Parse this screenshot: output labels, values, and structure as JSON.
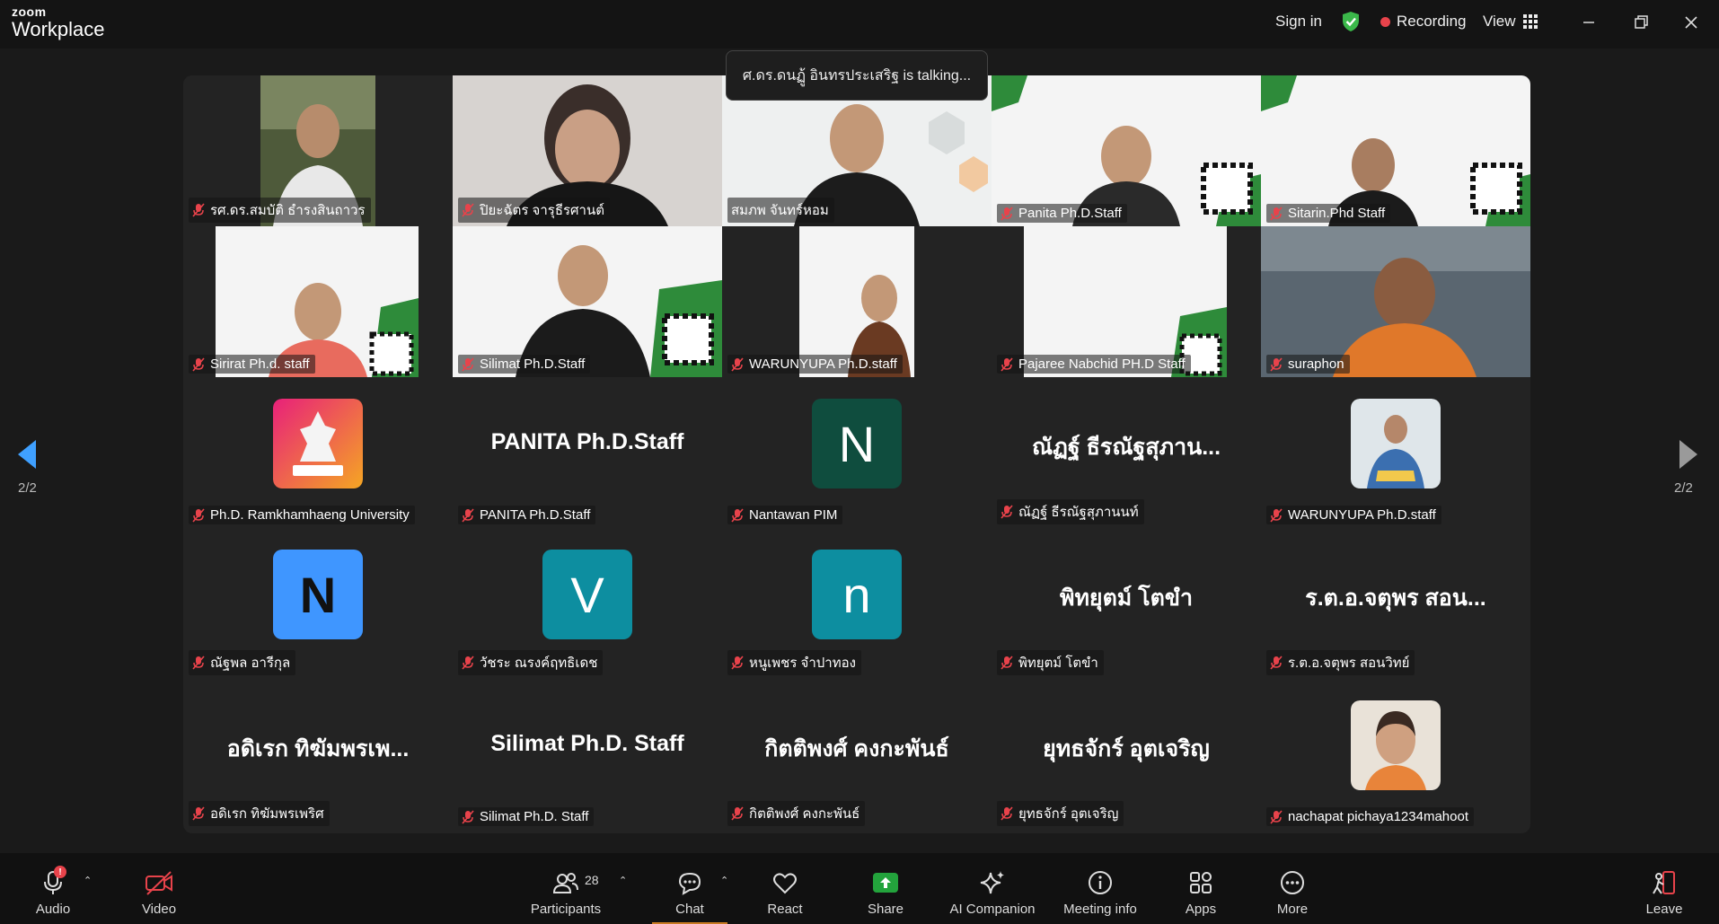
{
  "app": {
    "logo_top": "zoom",
    "logo_bottom": "Workplace"
  },
  "topbar": {
    "sign_in": "Sign in",
    "recording": "Recording",
    "view": "View",
    "colors": {
      "shield": "#3bb84a",
      "recording_dot": "#e8434b"
    }
  },
  "talking_banner": "ศ.ดร.ดนฏู้ อินทรประเสริฐ is talking...",
  "tiles": [
    {
      "name": "รศ.ดร.สมบัติ ธำรงสินถาวร",
      "type": "video"
    },
    {
      "name": "ปิยะฉัตร จารุธีรศานต์",
      "type": "video"
    },
    {
      "name": "สมภพ จันทร์หอม",
      "type": "video"
    },
    {
      "name": "Panita Ph.D.Staff",
      "type": "video"
    },
    {
      "name": "Sitarin.Phd Staff",
      "type": "video"
    },
    {
      "name": "Sirirat Ph.d. staff",
      "type": "video"
    },
    {
      "name": "Silimat Ph.D.Staff",
      "type": "video"
    },
    {
      "name": "WARUNYUPA Ph.D.staff",
      "type": "video"
    },
    {
      "name": "Pajaree Nabchid PH.D Staff",
      "type": "video"
    },
    {
      "name": "suraphon",
      "type": "video"
    },
    {
      "name": "Ph.D. Ramkhamhaeng University",
      "type": "avatar-image"
    },
    {
      "name": "PANITA Ph.D.Staff",
      "display": "PANITA Ph.D.Staff",
      "type": "text"
    },
    {
      "name": "Nantawan PIM",
      "initial": "N",
      "type": "initial",
      "color": "#0f4d3e"
    },
    {
      "name": "ณัฏฐ์ ธีรณัฐสุภานนท์",
      "display": "ณัฏฐ์ ธีรณัฐสุภาน...",
      "type": "text"
    },
    {
      "name": "WARUNYUPA Ph.D.staff",
      "type": "avatar-image"
    },
    {
      "name": "ณัฐพล อารีกุล",
      "initial": "N",
      "type": "initial",
      "color": "#3f96ff"
    },
    {
      "name": "วัชระ ณรงค์ฤทธิเดช",
      "initial": "V",
      "type": "initial",
      "color": "#0d8ea0"
    },
    {
      "name": "หนูเพชร จำปาทอง",
      "initial": "n",
      "type": "initial",
      "color": "#0d8ea0"
    },
    {
      "name": "พิทยุตม์ โตขำ",
      "display": "พิทยุตม์ โตขำ",
      "type": "text"
    },
    {
      "name": "ร.ต.อ.จตุพร สอนวิทย์",
      "display": "ร.ต.อ.จตุพร สอน...",
      "type": "text"
    },
    {
      "name": "อดิเรก ทิฆัมพรเพริศ",
      "display": "อดิเรก ทิฆัมพรเพ...",
      "type": "text"
    },
    {
      "name": "Silimat Ph.D. Staff",
      "display": "Silimat Ph.D. Staff",
      "type": "text"
    },
    {
      "name": "กิตติพงศ์ คงกะพันธ์",
      "display": "กิตติพงศ์ คงกะพันธ์",
      "type": "text"
    },
    {
      "name": "ยุทธจักร์ อุตเจริญ",
      "display": "ยุทธจักร์ อุตเจริญ",
      "type": "text"
    },
    {
      "name": "nachapat pichaya1234mahoot",
      "type": "avatar-image"
    }
  ],
  "pagination": {
    "left": "2/2",
    "right": "2/2"
  },
  "toolbar": {
    "audio": "Audio",
    "video": "Video",
    "participants": "Participants",
    "participants_count": "28",
    "chat": "Chat",
    "react": "React",
    "share": "Share",
    "ai_companion": "AI Companion",
    "meeting_info": "Meeting info",
    "apps": "Apps",
    "more": "More",
    "leave": "Leave",
    "audio_badge": "!",
    "colors": {
      "share": "#23a33c",
      "leave": "#e8434b",
      "chat_underline": "#c97b22"
    }
  }
}
